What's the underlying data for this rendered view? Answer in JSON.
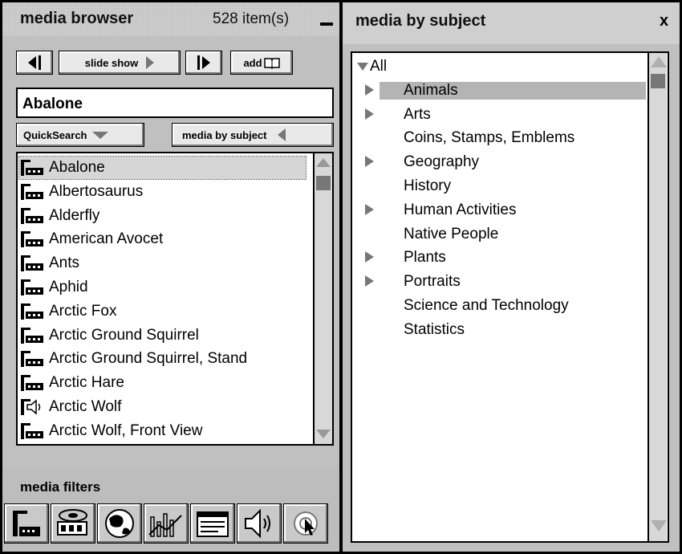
{
  "left_panel": {
    "title": "media browser",
    "item_count": "528 item(s)",
    "toolbar": {
      "slideshow_label": "slide show",
      "add_label": "add"
    },
    "search_value": "Abalone",
    "quicksearch_label": "QuickSearch",
    "subject_label": "media by subject",
    "items": [
      {
        "label": "Abalone",
        "icon": "image-icon",
        "selected": true
      },
      {
        "label": "Albertosaurus",
        "icon": "image-icon"
      },
      {
        "label": "Alderfly",
        "icon": "image-icon"
      },
      {
        "label": "American Avocet",
        "icon": "image-icon"
      },
      {
        "label": "Ants",
        "icon": "image-icon"
      },
      {
        "label": "Aphid",
        "icon": "image-icon"
      },
      {
        "label": "Arctic Fox",
        "icon": "image-icon"
      },
      {
        "label": "Arctic Ground Squirrel",
        "icon": "image-icon"
      },
      {
        "label": "Arctic Ground Squirrel, Stand",
        "icon": "image-icon"
      },
      {
        "label": "Arctic Hare",
        "icon": "image-icon"
      },
      {
        "label": "Arctic Wolf",
        "icon": "sound-icon"
      },
      {
        "label": "Arctic Wolf, Front View",
        "icon": "image-icon"
      }
    ],
    "filters_label": "media filters",
    "filters": [
      "images-filter-icon",
      "video-filter-icon",
      "maps-filter-icon",
      "charts-filter-icon",
      "text-filter-icon",
      "sound-filter-icon",
      "all-media-filter-icon"
    ]
  },
  "right_panel": {
    "title": "media by subject",
    "close_label": "x",
    "tree": [
      {
        "label": "All",
        "expander": "expanded",
        "level": 0
      },
      {
        "label": "Animals",
        "expander": "collapsed",
        "level": 1,
        "selected": true
      },
      {
        "label": "Arts",
        "expander": "collapsed",
        "level": 1
      },
      {
        "label": "Coins, Stamps, Emblems",
        "expander": "none",
        "level": 1
      },
      {
        "label": "Geography",
        "expander": "collapsed",
        "level": 1
      },
      {
        "label": "History",
        "expander": "none",
        "level": 1
      },
      {
        "label": "Human Activities",
        "expander": "collapsed",
        "level": 1
      },
      {
        "label": "Native People",
        "expander": "none",
        "level": 1
      },
      {
        "label": "Plants",
        "expander": "collapsed",
        "level": 1
      },
      {
        "label": "Portraits",
        "expander": "collapsed",
        "level": 1
      },
      {
        "label": "Science and Technology",
        "expander": "none",
        "level": 1
      },
      {
        "label": "Statistics",
        "expander": "none",
        "level": 1
      }
    ]
  },
  "colors": {
    "selection": "#b4b4b4",
    "panel": "#c0c0c0",
    "border": "#000000"
  }
}
